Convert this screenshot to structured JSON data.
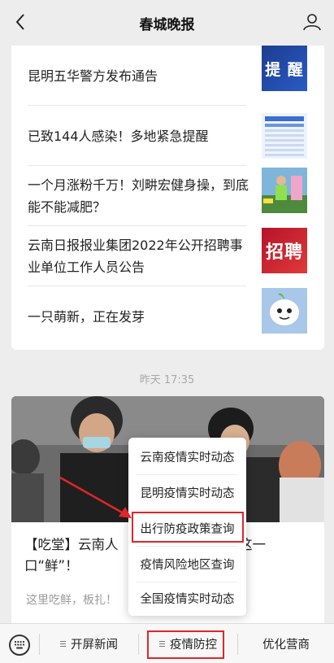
{
  "header": {
    "title": "春城晚报"
  },
  "articles": [
    {
      "headline": "昆明五华警方发布通告",
      "thumb_text": "提 醒",
      "thumb": "notice-thumb"
    },
    {
      "headline": "已致144人感染！多地紧急提醒",
      "thumb_text": "",
      "thumb": "table-thumb"
    },
    {
      "headline": "一个月涨粉千万！刘畊宏健身操，到底能不能减肥？",
      "thumb_text": "",
      "thumb": "fitness-thumb"
    },
    {
      "headline": "云南日报报业集团2022年公开招聘事业单位工作人员公告",
      "thumb_text": "招聘",
      "thumb": "recruit-thumb"
    },
    {
      "headline": "一只萌新，正在发芽",
      "thumb_text": "",
      "thumb": "mascot-thumb"
    }
  ],
  "timestamp": "昨天 17:35",
  "feature": {
    "title_left": "【吃堂】云南人",
    "title_right": "了这一",
    "title_line2": "口“鲜”！",
    "subtitle": "这里吃鲜，板扎！"
  },
  "popup_menu": {
    "items": [
      "云南疫情实时动态",
      "昆明疫情实时动态",
      "出行防疫政策查询",
      "疫情风险地区查询",
      "全国疫情实时动态"
    ]
  },
  "bottom_menu": {
    "items": [
      "开屏新闻",
      "疫情防控",
      "优化营商"
    ]
  },
  "colors": {
    "highlight": "#e0262a",
    "background": "#ededed"
  },
  "icons": [
    "back-arrow-icon",
    "profile-icon",
    "keyboard-icon",
    "menu-lines-icon"
  ]
}
